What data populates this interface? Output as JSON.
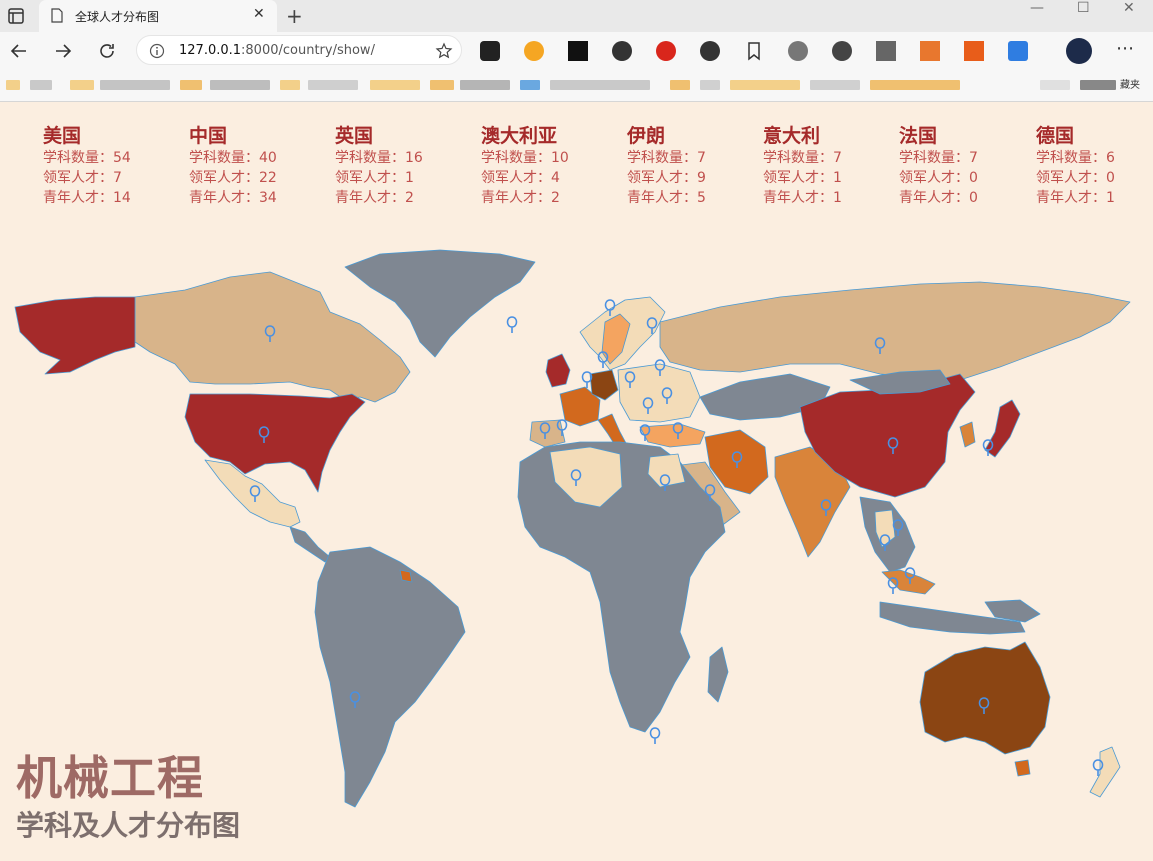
{
  "browser": {
    "tab_title": "全球人才分布图",
    "url_host": "127.0.0.1",
    "url_rest": ":8000/country/show/",
    "bookmarks_trailing": "藏夹"
  },
  "stats": [
    {
      "name": "美国",
      "subjects": "学科数量：54",
      "leaders": "领军人才：7",
      "youth": "青年人才：14"
    },
    {
      "name": "中国",
      "subjects": "学科数量：40",
      "leaders": "领军人才：22",
      "youth": "青年人才：34"
    },
    {
      "name": "英国",
      "subjects": "学科数量：16",
      "leaders": "领军人才：1",
      "youth": "青年人才：2"
    },
    {
      "name": "澳大利亚",
      "subjects": "学科数量：10",
      "leaders": "领军人才：4",
      "youth": "青年人才：2"
    },
    {
      "name": "伊朗",
      "subjects": "学科数量：7",
      "leaders": "领军人才：9",
      "youth": "青年人才：5"
    },
    {
      "name": "意大利",
      "subjects": "学科数量：7",
      "leaders": "领军人才：1",
      "youth": "青年人才：1"
    },
    {
      "name": "法国",
      "subjects": "学科数量：7",
      "leaders": "领军人才：0",
      "youth": "青年人才：0"
    },
    {
      "name": "德国",
      "subjects": "学科数量：6",
      "leaders": "领军人才：0",
      "youth": "青年人才：1"
    }
  ],
  "map": {
    "colors": {
      "ocean": "#fbeee0",
      "default": "#7f8792",
      "light": "#d8b48a",
      "pale": "#f3dcb8",
      "medium": "#d9843a",
      "strong": "#d2691e",
      "top": "#a52a2a",
      "australia": "#8b4513",
      "border": "#4a9ad4",
      "pin": "#4a90e2"
    }
  },
  "title": {
    "main": "机械工程",
    "sub": "学科及人才分布图"
  }
}
